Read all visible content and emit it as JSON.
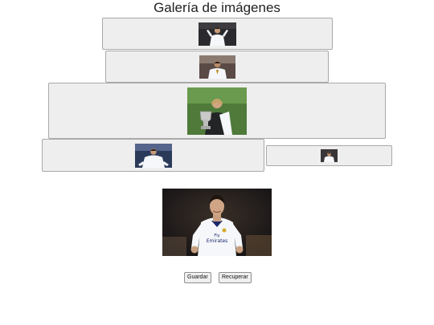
{
  "page": {
    "title": "Galería de imágenes"
  },
  "gallery": {
    "items": [
      {
        "photo": "player-photo",
        "subject": "jersey-celebration"
      },
      {
        "photo": "player-photo",
        "subject": "jersey-portrait"
      },
      {
        "photo": "player-photo",
        "subject": "trophy-holder"
      },
      {
        "photo": "player-photo",
        "subject": "crouching-player"
      },
      {
        "photo": "player-photo",
        "subject": "small-player"
      }
    ]
  },
  "preview": {
    "photo": "player-photo",
    "subject": "celebrating-player"
  },
  "actions": {
    "save_label": "Guardar",
    "restore_label": "Recuperar"
  },
  "colors": {
    "box_bg": "#eeeeee",
    "box_border": "#a9a9a9",
    "jersey": "#f5f7fa",
    "stadium": "#1c1a1a"
  }
}
